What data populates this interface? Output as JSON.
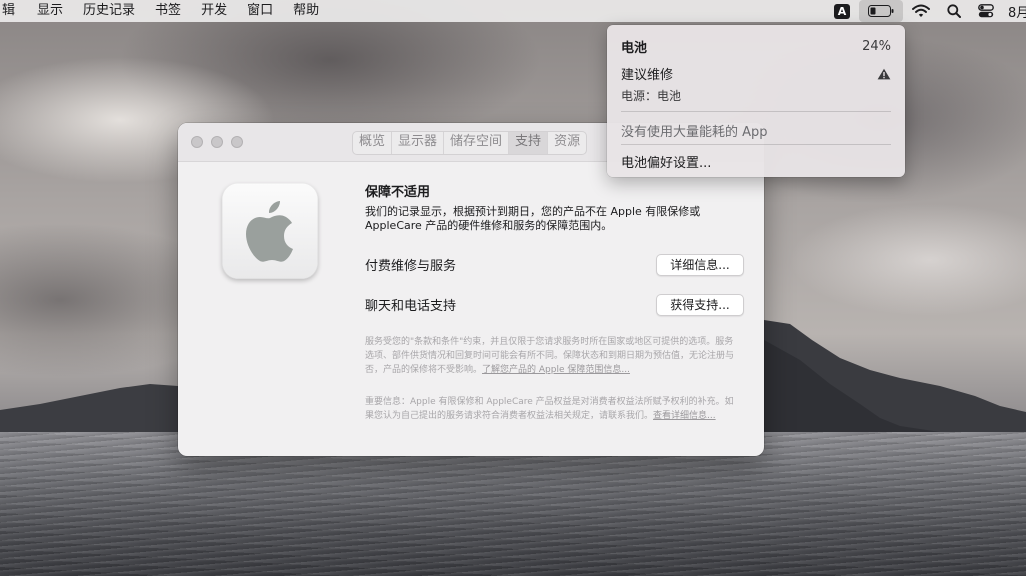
{
  "menubar": {
    "items": [
      "辑",
      "显示",
      "历史记录",
      "书签",
      "开发",
      "窗口",
      "帮助"
    ],
    "input_source": "A",
    "clock": "8月"
  },
  "battery_menu": {
    "title": "电池",
    "percent": "24%",
    "condition": "建议维修",
    "power_source": "电源：电池",
    "no_apps": "没有使用大量能耗的 App",
    "preferences": "电池偏好设置..."
  },
  "window": {
    "tabs": [
      {
        "label": "概览",
        "active": false
      },
      {
        "label": "显示器",
        "active": false
      },
      {
        "label": "储存空间",
        "active": false
      },
      {
        "label": "支持",
        "active": true
      },
      {
        "label": "资源",
        "active": false
      }
    ],
    "heading": "保障不适用",
    "description": "我们的记录显示，根据预计到期日，您的产品不在 Apple 有限保修或 AppleCare 产品的硬件维修和服务的保障范围内。",
    "rows": [
      {
        "label": "付费维修与服务",
        "button": "详细信息..."
      },
      {
        "label": "聊天和电话支持",
        "button": "获得支持..."
      }
    ],
    "fine_print_1": "服务受您的\"条款和条件\"约束，并且仅限于您请求服务时所在国家或地区可提供的选项。服务选项、部件供货情况和回复时间可能会有所不同。保障状态和到期日期为预估值，无论注册与否，产品的保修将不受影响。",
    "fine_print_1_link": "了解您产品的 Apple 保障范围信息...",
    "fine_print_2": "重要信息：Apple 有限保修和 AppleCare 产品权益是对消费者权益法所赋予权利的补充。如果您认为自己提出的服务请求符合消费者权益法相关规定，请联系我们。",
    "fine_print_2_link": "查看详细信息..."
  },
  "colors": {
    "menubar_bg": "#ECEAEA",
    "window_bg": "#F1F0F1",
    "warning": "#3A3A3C"
  },
  "icons": [
    "battery-low-icon",
    "wifi-icon",
    "search-icon",
    "control-center-icon",
    "warning-icon",
    "apple-logo-icon"
  ]
}
